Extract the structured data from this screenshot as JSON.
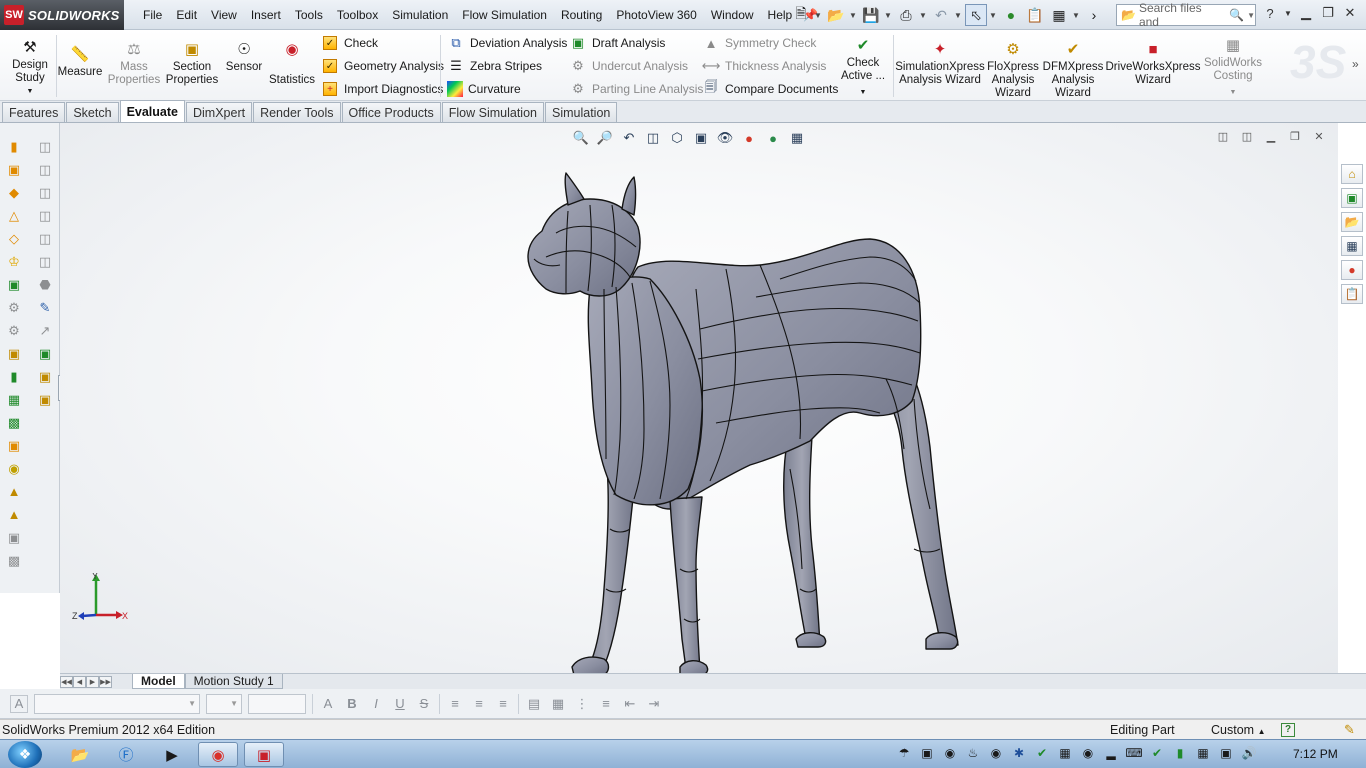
{
  "app": {
    "brand": "SOLIDWORKS",
    "logo_text": "SW"
  },
  "menu": [
    "File",
    "Edit",
    "View",
    "Insert",
    "Tools",
    "Toolbox",
    "Simulation",
    "Flow Simulation",
    "Routing",
    "PhotoView 360",
    "Window",
    "Help"
  ],
  "search": {
    "placeholder": "Search files and"
  },
  "ribbon": {
    "design_study": "Design Study",
    "measure": "Measure",
    "mass_properties": "Mass Properties",
    "section_properties": "Section Properties",
    "sensor": "Sensor",
    "statistics": "Statistics",
    "check": "Check",
    "geometry_analysis": "Geometry Analysis",
    "import_diagnostics": "Import Diagnostics",
    "deviation_analysis": "Deviation Analysis",
    "zebra_stripes": "Zebra Stripes",
    "curvature": "Curvature",
    "draft_analysis": "Draft Analysis",
    "undercut_analysis": "Undercut Analysis",
    "parting_line_analysis": "Parting Line Analysis",
    "symmetry_check": "Symmetry Check",
    "thickness_analysis": "Thickness Analysis",
    "compare_documents": "Compare Documents",
    "check_active": "Check Active ...",
    "simulationxpress": "SimulationXpress Analysis Wizard",
    "floxpress": "FloXpress Analysis Wizard",
    "dfmxpress": "DFMXpress Analysis Wizard",
    "driveworksxpress": "DriveWorksXpress Wizard",
    "solidworks_costing": "SolidWorks Costing"
  },
  "tabs": [
    "Features",
    "Sketch",
    "Evaluate",
    "DimXpert",
    "Render Tools",
    "Office Products",
    "Flow Simulation",
    "Simulation"
  ],
  "active_tab": "Evaluate",
  "triad": {
    "x": "X",
    "y": "Y",
    "z": "Z"
  },
  "model_tabs": [
    "Model",
    "Motion Study 1"
  ],
  "format_bar": {
    "bold": "B",
    "italic": "I",
    "underline": "U",
    "strike": "S"
  },
  "status": {
    "edition": "SolidWorks Premium 2012 x64 Edition",
    "editing": "Editing Part",
    "units": "Custom",
    "help": "?"
  },
  "taskbar": {
    "clock": "7:12 PM"
  },
  "colors": {
    "accent": "#c8202a",
    "model_fill": "#8a8ea0",
    "model_edge": "#141414",
    "active_tab_bg": "#ffffff"
  }
}
